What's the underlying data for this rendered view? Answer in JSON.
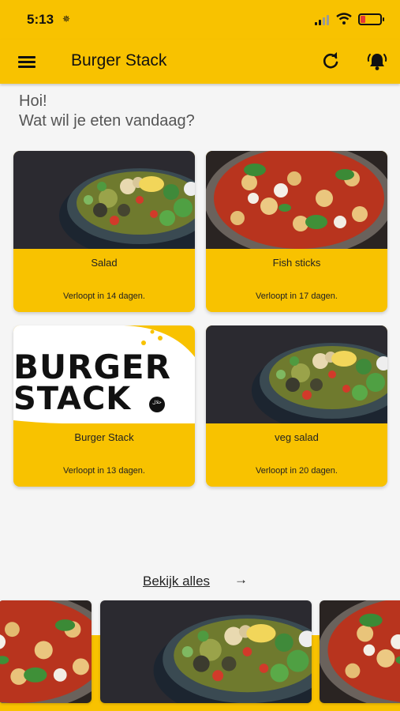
{
  "status_bar": {
    "time": "5:13",
    "location_glyph": "✵"
  },
  "app_bar": {
    "title": "Burger Stack",
    "menu_icon": "hamburger-menu-icon",
    "refresh_icon": "refresh-icon",
    "notification_icon": "bell-icon"
  },
  "greeting": {
    "line1": "Hoi!",
    "line2": "Wat wil je eten vandaag?"
  },
  "cards": [
    {
      "name": "Salad",
      "expires": "Verloopt in 14 dagen.",
      "image": "salad-bowl"
    },
    {
      "name": "Fish sticks",
      "expires": "Verloopt in 17 dagen.",
      "image": "tomato-gnocchi"
    },
    {
      "name": "Burger Stack",
      "expires": "Verloopt in 13 dagen.",
      "image": "burger-stack-logo",
      "logo_line1": "BURGER",
      "logo_line2": "STACK",
      "logo_badge": "حلال"
    },
    {
      "name": "veg salad",
      "expires": "Verloopt in 20 dagen.",
      "image": "salad-bowl"
    }
  ],
  "view_all": {
    "label": "Bekijk alles",
    "arrow": "→"
  },
  "colors": {
    "brand_yellow": "#f8c200",
    "background": "#f5f5f5"
  }
}
